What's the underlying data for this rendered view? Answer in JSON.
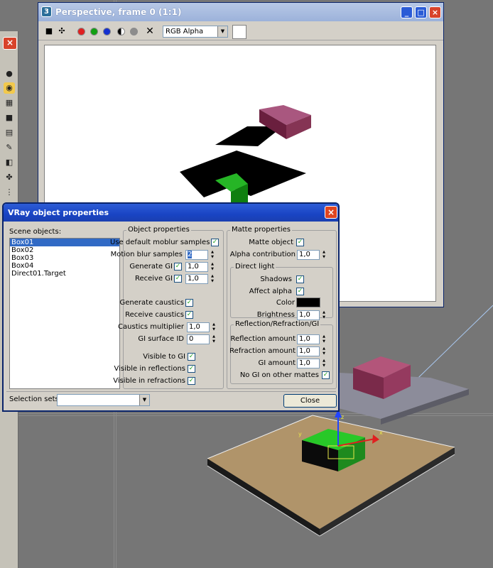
{
  "render_window": {
    "title": "Perspective, frame 0 (1:1)",
    "channel": "RGB Alpha",
    "toolbar_icons": [
      "save-icon",
      "clone-icon",
      "red-channel-icon",
      "green-channel-icon",
      "blue-channel-icon",
      "alpha-channel-icon",
      "mono-channel-icon",
      "clear-icon"
    ]
  },
  "vray_dialog": {
    "title": "VRay object properties",
    "scene_objects_label": "Scene objects:",
    "scene_objects": [
      "Box01",
      "Box02",
      "Box03",
      "Box04",
      "Direct01.Target"
    ],
    "selected_object": "Box01",
    "object_properties": {
      "group_title": "Object properties",
      "use_default_moblur": "Use default moblur samples",
      "motion_blur_samples": "Motion blur samples",
      "motion_blur_value": "2",
      "generate_gi": "Generate GI",
      "generate_gi_value": "1,0",
      "receive_gi": "Receive GI",
      "receive_gi_value": "1,0",
      "generate_caustics": "Generate caustics",
      "receive_caustics": "Receive caustics",
      "caustics_multiplier": "Caustics multiplier",
      "caustics_multiplier_value": "1,0",
      "gi_surface_id": "GI surface ID",
      "gi_surface_id_value": "0",
      "visible_to_gi": "Visible to GI",
      "visible_in_reflections": "Visible in reflections",
      "visible_in_refractions": "Visible in refractions"
    },
    "matte_properties": {
      "group_title": "Matte properties",
      "matte_object": "Matte object",
      "alpha_contribution": "Alpha contribution",
      "alpha_contribution_value": "1,0",
      "direct_light_title": "Direct light",
      "shadows": "Shadows",
      "affect_alpha": "Affect alpha",
      "color": "Color",
      "color_value": "#000000",
      "brightness": "Brightness",
      "brightness_value": "1,0",
      "rrg_title": "Reflection/Refraction/GI",
      "reflection_amount": "Reflection amount",
      "reflection_amount_value": "1,0",
      "refraction_amount": "Refraction amount",
      "refraction_amount_value": "1,0",
      "gi_amount": "GI amount",
      "gi_amount_value": "1,0",
      "no_gi_on_other_mattes": "No GI on other mattes"
    },
    "selection_sets_label": "Selection sets:",
    "selection_sets_value": "",
    "close_label": "Close"
  },
  "colors": {
    "dialog_title_blue": "#1944c4",
    "selection_blue": "#316ac5",
    "box_pink": "#8a3a5a",
    "box_green": "#1d9a1d",
    "floor_tan": "#b0946a"
  },
  "left_toolbar_icons": [
    "sphere-icon",
    "teapot-icon",
    "checker-icon",
    "square-icon",
    "gradient-icon",
    "wrench-icon",
    "material-icon",
    "objects-icon",
    "hierarchy-icon"
  ]
}
